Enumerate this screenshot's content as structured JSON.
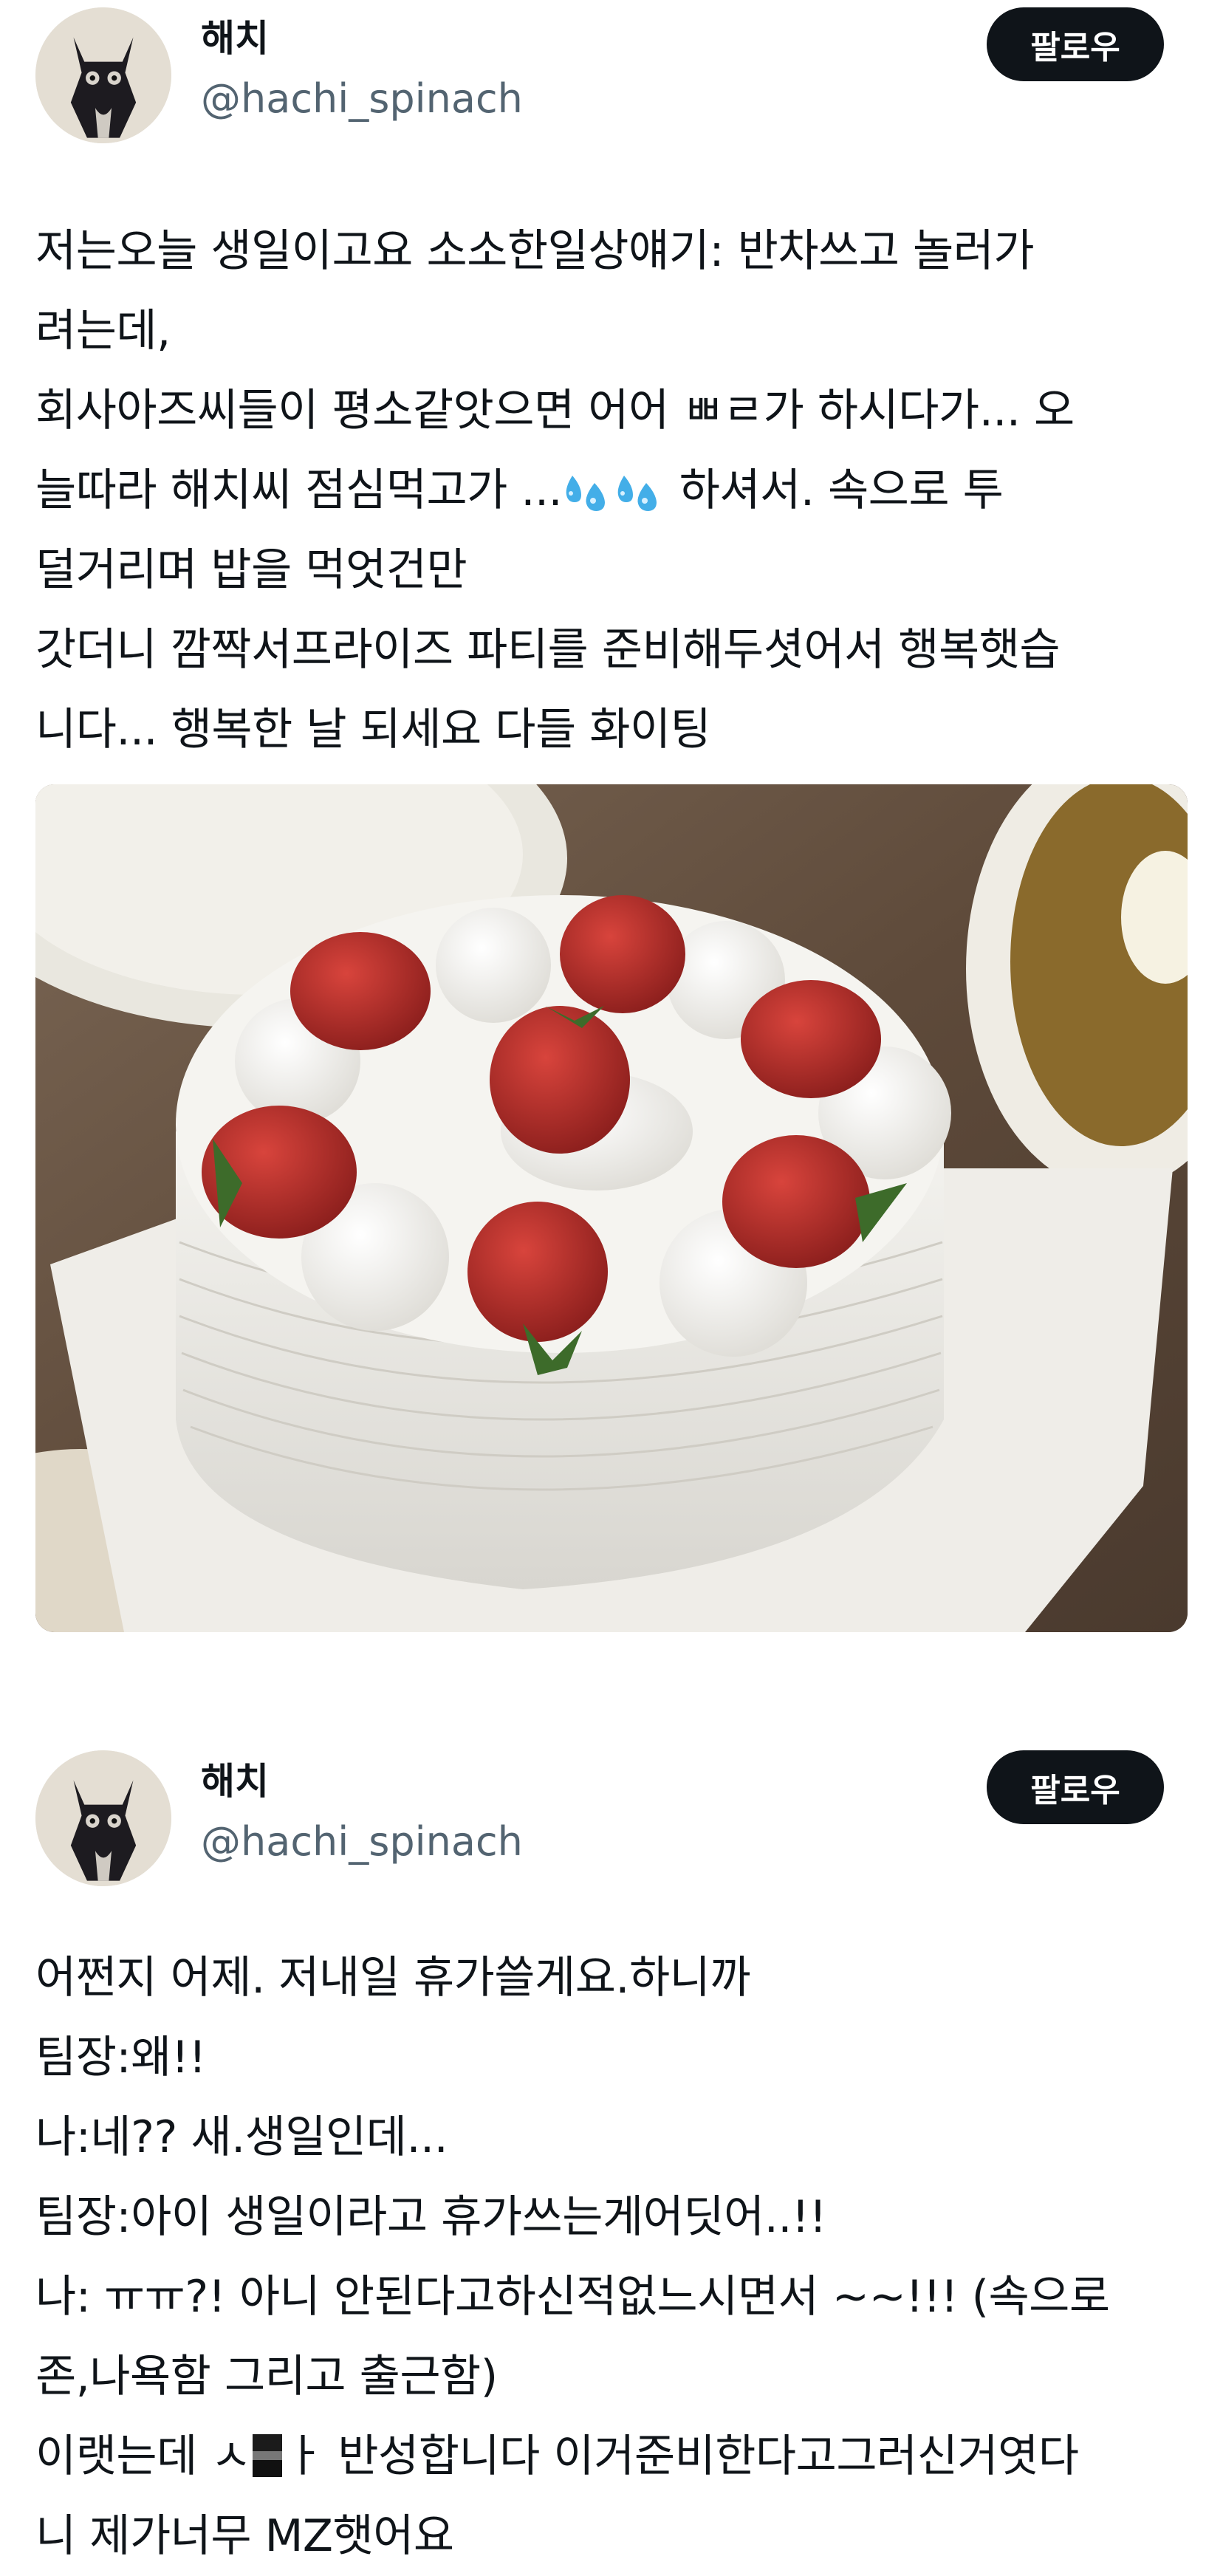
{
  "posts": [
    {
      "author": {
        "name": "해치",
        "handle": "@hachi_spinach"
      },
      "follow_label": "팔로우",
      "lines": [
        "저는오늘 생일이고요  소소한일상얘기: 반차쓰고 놀러가",
        "려는데,",
        "회사아즈씨들이 평소같앗으면 어어 ㅃㄹ가 하시다가... 오",
        {
          "before": "늘따라 해치씨   점심먹고가 ...",
          "after": " 하셔서. 속으로  투"
        },
        "덜거리며 밥을 먹엇건만",
        "갓더니 깜짝서프라이즈 파티를 준비해두셧어서 행복햇습",
        "니다... 행복한 날 되세요 다들   화이팅"
      ],
      "inline_icons": [
        "sweat-droplets-icon",
        "sweat-droplets-icon"
      ],
      "image": {
        "subject": "strawberry-cream-cake-photo"
      }
    },
    {
      "author": {
        "name": "해치",
        "handle": "@hachi_spinach"
      },
      "follow_label": "팔로우",
      "lines": [
        "어쩐지 어제. 저내일 휴가쓸게요.하니까",
        "팀장:왜!!",
        "나:네?? 새.생일인데...",
        "팀장:아이 생일이라고  휴가쓰는게어딧어..!!",
        "나:  ㅠㅠ?! 아니 안된다고하신적없느시면서 ~~!!! (속으로",
        "존,나욕함  그리고 출근함)",
        {
          "before": "이랫는데  ㅅ",
          "after": "ㅏ 반성합니다 이거준비한다고그러신거엿다"
        },
        "니 제가너무 MZ햇어요"
      ],
      "inline_icons": [
        "censor-icon"
      ]
    }
  ],
  "colors": {
    "text": "#0f1419",
    "handle": "#536471",
    "follow_bg": "#0f1419",
    "follow_text": "#ffffff"
  }
}
